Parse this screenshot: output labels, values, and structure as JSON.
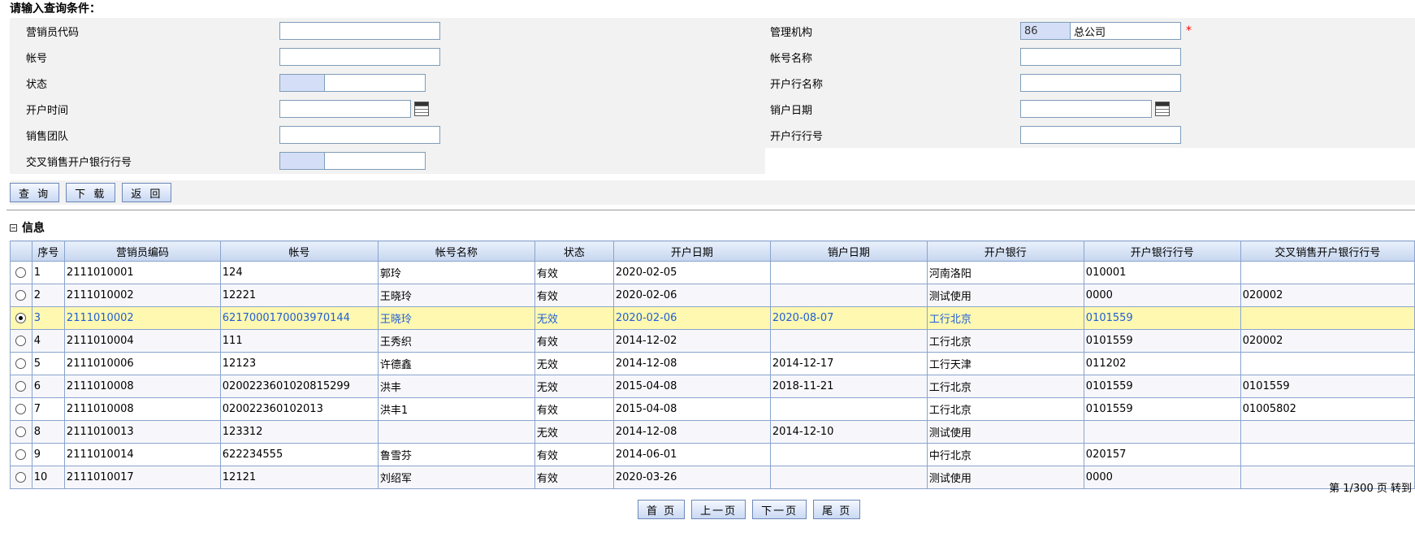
{
  "form": {
    "title": "请输入查询条件：",
    "fields": {
      "agent_code": {
        "label": "营销员代码",
        "value": ""
      },
      "mgmt_org": {
        "label": "管理机构",
        "code": "86",
        "name": "总公司",
        "required_mark": "*"
      },
      "account_no": {
        "label": "帐号",
        "value": ""
      },
      "account_name": {
        "label": "帐号名称",
        "value": ""
      },
      "status": {
        "label": "状态",
        "code": "",
        "name": ""
      },
      "bank_name": {
        "label": "开户行名称",
        "value": ""
      },
      "open_date": {
        "label": "开户时间",
        "value": ""
      },
      "close_date": {
        "label": "销户日期",
        "value": ""
      },
      "sales_team": {
        "label": "销售团队",
        "value": ""
      },
      "bank_code": {
        "label": "开户行行号",
        "value": ""
      },
      "cross_bank_code": {
        "label": "交叉销售开户银行行号",
        "code": "",
        "name": ""
      }
    },
    "buttons": {
      "query": "查 询",
      "download": "下 载",
      "back": "返 回"
    }
  },
  "info": {
    "section_title": "信息",
    "columns": [
      "序号",
      "营销员编码",
      "帐号",
      "帐号名称",
      "状态",
      "开户日期",
      "销户日期",
      "开户银行",
      "开户银行行号",
      "交叉销售开户银行行号"
    ],
    "rows": [
      {
        "no": "1",
        "code": "2111010001",
        "account": "124",
        "name": "郭玲",
        "status": "有效",
        "open": "2020-02-05",
        "close": "",
        "bank": "河南洛阳",
        "bank_no": "010001",
        "cross": ""
      },
      {
        "no": "2",
        "code": "2111010002",
        "account": "12221",
        "name": "王晓玲",
        "status": "有效",
        "open": "2020-02-06",
        "close": "",
        "bank": "测试使用",
        "bank_no": "0000",
        "cross": "020002"
      },
      {
        "no": "3",
        "code": "2111010002",
        "account": "6217000170003970144",
        "name": "王晓玲",
        "status": "无效",
        "open": "2020-02-06",
        "close": "2020-08-07",
        "bank": "工行北京",
        "bank_no": "0101559",
        "cross": ""
      },
      {
        "no": "4",
        "code": "2111010004",
        "account": "111",
        "name": "王秀织",
        "status": "有效",
        "open": "2014-12-02",
        "close": "",
        "bank": "工行北京",
        "bank_no": "0101559",
        "cross": "020002"
      },
      {
        "no": "5",
        "code": "2111010006",
        "account": "12123",
        "name": "许德鑫",
        "status": "无效",
        "open": "2014-12-08",
        "close": "2014-12-17",
        "bank": "工行天津",
        "bank_no": "011202",
        "cross": ""
      },
      {
        "no": "6",
        "code": "2111010008",
        "account": "0200223601020815299",
        "name": "洪丰",
        "status": "无效",
        "open": "2015-04-08",
        "close": "2018-11-21",
        "bank": "工行北京",
        "bank_no": "0101559",
        "cross": "0101559"
      },
      {
        "no": "7",
        "code": "2111010008",
        "account": "020022360102013",
        "name": "洪丰1",
        "status": "有效",
        "open": "2015-04-08",
        "close": "",
        "bank": "工行北京",
        "bank_no": "0101559",
        "cross": "01005802"
      },
      {
        "no": "8",
        "code": "2111010013",
        "account": "123312",
        "name": "",
        "status": "无效",
        "open": "2014-12-08",
        "close": "2014-12-10",
        "bank": "测试使用",
        "bank_no": "",
        "cross": ""
      },
      {
        "no": "9",
        "code": "2111010014",
        "account": "622234555",
        "name": "鲁雪芬",
        "status": "有效",
        "open": "2014-06-01",
        "close": "",
        "bank": "中行北京",
        "bank_no": "020157",
        "cross": ""
      },
      {
        "no": "10",
        "code": "2111010017",
        "account": "12121",
        "name": "刘绍军",
        "status": "有效",
        "open": "2020-03-26",
        "close": "",
        "bank": "测试使用",
        "bank_no": "0000",
        "cross": ""
      }
    ],
    "selected_row": 3
  },
  "pager": {
    "page_info": "第 1/300 页  转到",
    "first": "首 页",
    "prev": "上一页",
    "next": "下一页",
    "last": "尾 页"
  }
}
